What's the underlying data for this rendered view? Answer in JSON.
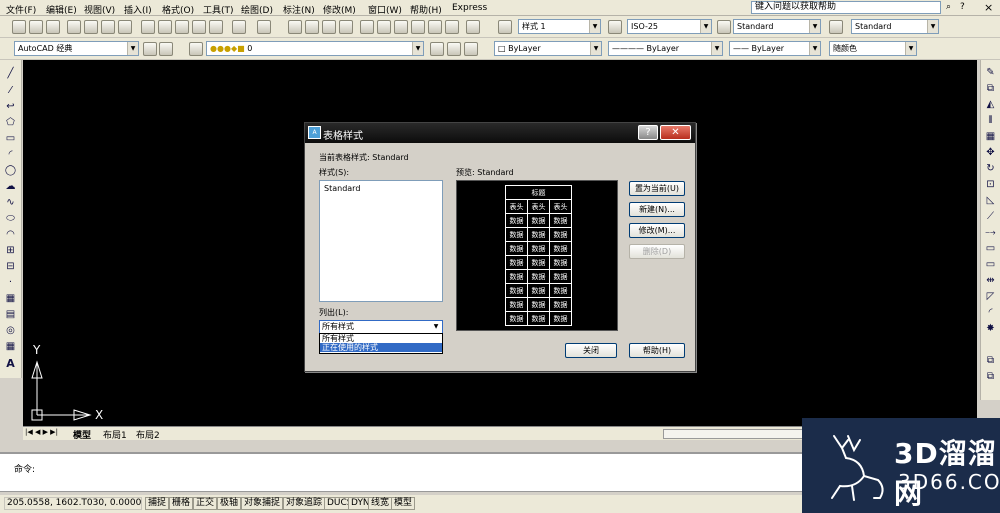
{
  "menu": [
    "文件(F)",
    "编辑(E)",
    "视图(V)",
    "插入(I)",
    "格式(O)",
    "工具(T)",
    "绘图(D)",
    "标注(N)",
    "修改(M)",
    "窗口(W)",
    "帮助(H)",
    "Express"
  ],
  "help_search": "键入问题以获取帮助",
  "styles_toolbar": {
    "text_style": "样式 1",
    "dim_style": "ISO-25",
    "table_style": "Standard",
    "mleader_style": "Standard"
  },
  "workspace": "AutoCAD 经典",
  "layer": "0",
  "props": {
    "color": "ByLayer",
    "linetype": "ByLayer",
    "lineweight": "ByLayer",
    "plotstyle": "随颜色"
  },
  "ucs": {
    "y": "Y",
    "x": "X"
  },
  "tabs": [
    "模型",
    "布局1",
    "布局2"
  ],
  "command_prompt": "命令:",
  "coords": "205.0558,  1602.T030, 0.0000",
  "status_buttons": [
    "捕捉",
    "栅格",
    "正交",
    "极轴",
    "对象捕捉",
    "对象追踪",
    "DUCS",
    "DYN",
    "线宽",
    "模型"
  ],
  "dialog": {
    "title": "表格样式",
    "current_style_label": "当前表格样式: Standard",
    "styles_label": "样式(S):",
    "styles": [
      "Standard"
    ],
    "preview_label": "预览: Standard",
    "preview_title": "标题",
    "preview_header": "表头",
    "preview_cell": "数据",
    "list_label": "列出(L):",
    "list_value": "所有样式",
    "list_options": [
      "所有样式",
      "正在使用的样式"
    ],
    "buttons": {
      "set_current": "置为当前(U)",
      "new": "新建(N)...",
      "modify": "修改(M)...",
      "delete": "删除(D)",
      "close": "关闭",
      "help": "帮助(H)"
    }
  },
  "watermark": {
    "brand": "3D溜溜网",
    "url": "3D66.COM"
  }
}
